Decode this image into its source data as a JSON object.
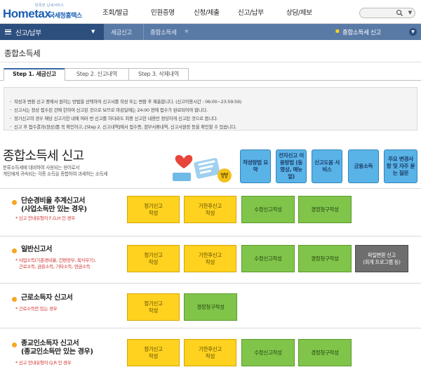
{
  "header": {
    "logo_slogan": "만족한 납세서비스",
    "logo_brand": "Hometax",
    "logo_org": "국세청홈택스",
    "nav": [
      "조회/발급",
      "민원증명",
      "신청/제출",
      "신고/납부",
      "상담/제보"
    ]
  },
  "navbar": {
    "menu_label": "신고/납부",
    "crumb1": "세금신고",
    "crumb2": "종합소득세",
    "current": "종합소득세 신고"
  },
  "page": {
    "title": "종합소득세",
    "tabs": [
      "Step 1. 세금신고",
      "Step 2. 신고내역",
      "Step 3. 삭제내역"
    ]
  },
  "notice": [
    "작성과 변환 신고 중에서 원하는 방법을 선택하여 신고서를 작성 또는 변환 후 제출합니다. (신고이용시간 : 06:00~23:59:59)",
    "신고서는 정상 접수된 건에 한하여 신고된 것으로 보므로 마감일에는 24:00 전에 접수가 완료되어야 합니다.",
    "정기신고의 경우 해당 신고기한 내에 여러 번 신고를 하더라도 최종 신고한 내용만 정당하게 신고된 것으로 봅니다.",
    "신고 후 접수결과(정상)를 꼭 확인하고, [Step 2. 신고내역]에서 접수증, 첨부서류내역, 신고서원장 등을 확인할 수 있습니다."
  ],
  "intro": {
    "title": "종합소득세 신고",
    "desc1": "분류소득세에 대비하여 사용되는 용어로서",
    "desc2": "개인에게 귀속되는 각종 소득을 종합하여 과세하는 소득세"
  },
  "quick": [
    "작성방법 요약",
    "전자신고 이용방법 (동영상, 매뉴얼)",
    "신고도움 서비스",
    "금융소득",
    "주요 변경사항 및 자주 묻는 질문"
  ],
  "rows": [
    {
      "t1": "단순경비율 추계신고서",
      "t2": "(사업소득만 있는 경우)",
      "n1": "* 신고 안내유형이 F,G,H 인 경우",
      "n2": ""
    },
    {
      "t1": "일반신고서",
      "t2": "",
      "n1": "* 사업소득(기준경비율, 간편장부, 복식부기),",
      "n2": "근로소득, 금융소득, 기타소득, 연금소득"
    },
    {
      "t1": "근로소득자 신고서",
      "t2": "",
      "n1": "* 근로소득만 있는 경우",
      "n2": ""
    },
    {
      "t1": "종교인소득자 신고서",
      "t2": "(종교인소득만 있는 경우)",
      "n1": "* 신고 안내유형이 Q,R 인 경우",
      "n2": ""
    }
  ],
  "buttons": {
    "regular_a": "정기신고",
    "regular_b": "작성",
    "late_a": "기한후신고",
    "late_b": "작성",
    "amend": "수정신고작성",
    "claim": "경정청구작성",
    "file_a": "파일변환 신고",
    "file_b": "(회계 프로그램 등)"
  },
  "colors": {
    "nav_dark": "#2d4f7e",
    "nav": "#5a7aa6",
    "yellow_btn": "#ffd21f",
    "green_btn": "#80c54a",
    "quick_btn": "#5ab3e6"
  }
}
